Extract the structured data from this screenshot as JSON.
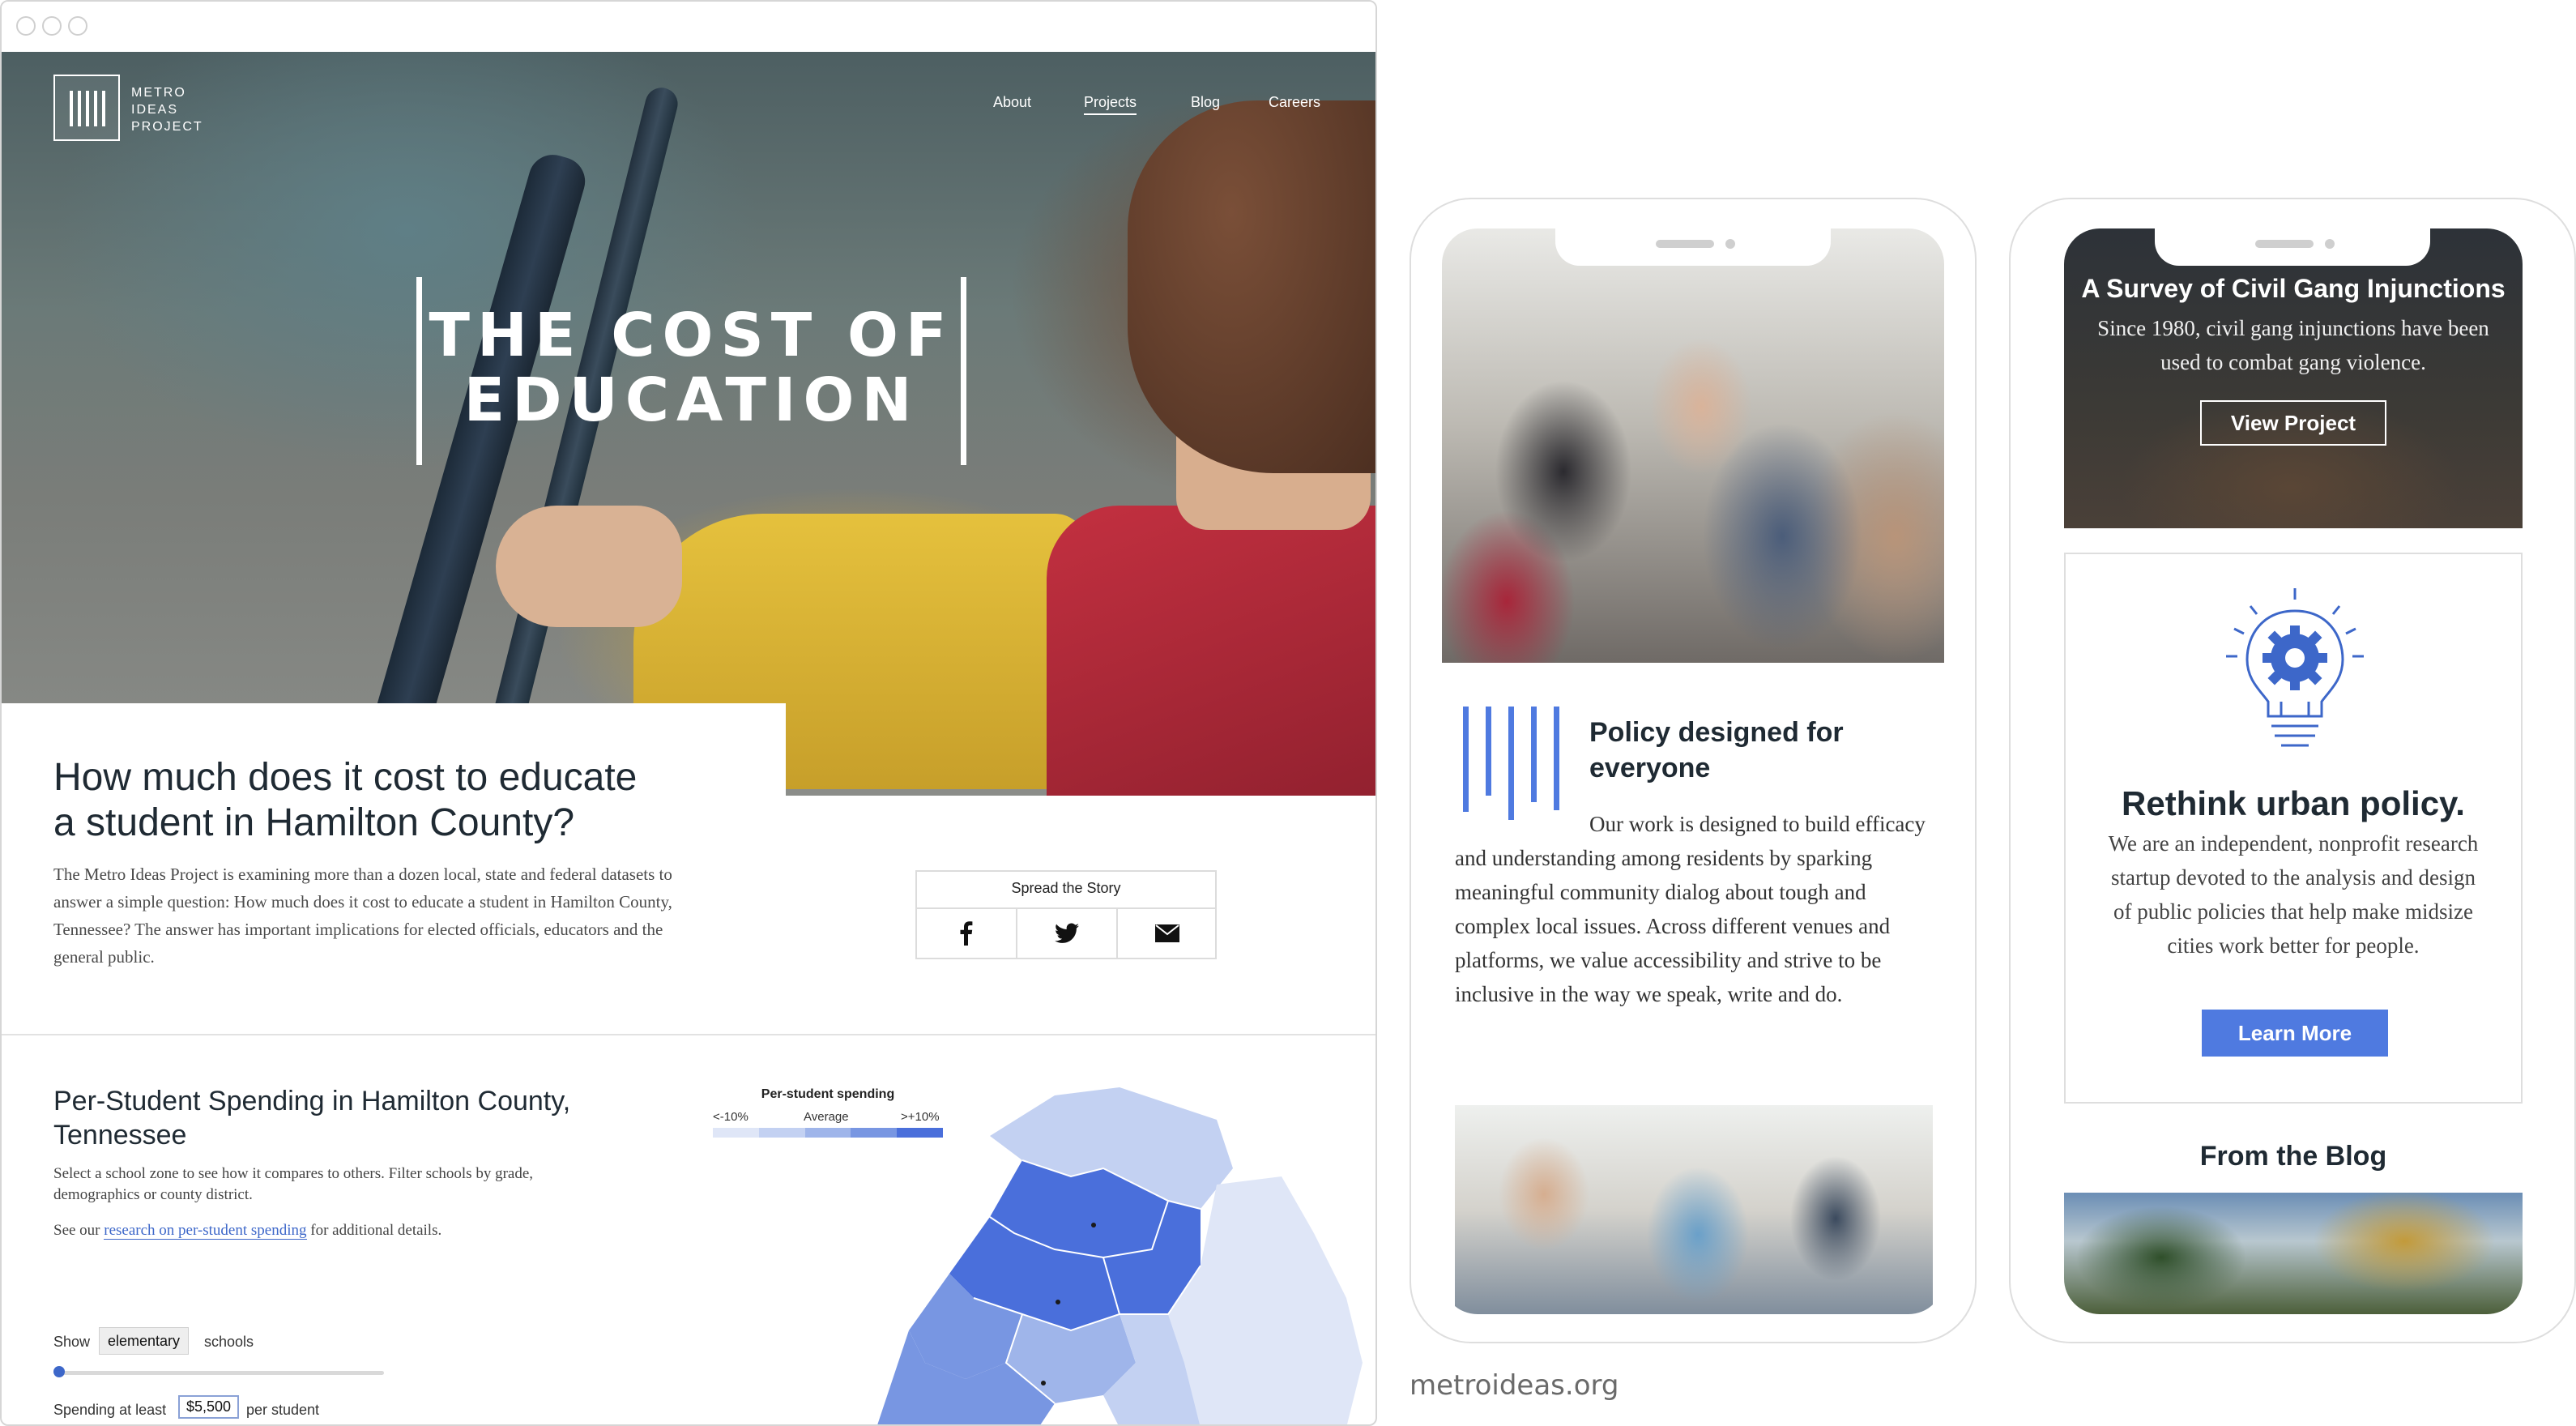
{
  "nav": {
    "logo_text": [
      "METRO",
      "IDEAS",
      "PROJECT"
    ],
    "items": [
      "About",
      "Projects",
      "Blog",
      "Careers"
    ],
    "active": "Projects"
  },
  "hero": {
    "title_line1": "THE COST OF",
    "title_line2": "EDUCATION"
  },
  "intro": {
    "heading": "How much does it cost to educate a student in Hamilton County?",
    "body": "The Metro Ideas Project is examining more than a dozen local, state and federal datasets to answer a simple question: How much does it cost to educate a student in Hamilton County, Tennessee? The answer has important implications for elected officials, educators and the general public."
  },
  "share": {
    "title": "Spread the Story",
    "buttons": [
      "facebook-icon",
      "twitter-icon",
      "email-icon"
    ]
  },
  "spending": {
    "heading": "Per-Student Spending in Hamilton County, Tennessee",
    "description": "Select a school zone to see how it compares to others. Filter schools by grade, demographics or county district.",
    "see_prefix": "See our ",
    "see_link": "research on per-student spending",
    "see_suffix": " for additional details.",
    "legend": {
      "title": "Per-student spending",
      "low": "<-10%",
      "avg": "Average",
      "high": ">+10%",
      "colors": [
        "#dfe6f7",
        "#c3d1f2",
        "#9fb5ea",
        "#7896e2",
        "#4a6fdb"
      ]
    },
    "filter": {
      "show_label": "Show",
      "grade": "elementary",
      "schools_label": "schools",
      "spending_label": "Spending at least",
      "amount": "$5,500",
      "per_student_label": "per student",
      "slider_value": 0
    }
  },
  "phone1": {
    "heading": "Policy designed for everyone",
    "body_first": "Our work is designed to build efficacy and understanding",
    "body_rest": "among residents by sparking meaningful community dialog about tough and complex local issues. Across different venues and platforms, we value accessibility and strive to be inclusive in the way we speak, write and do."
  },
  "phone2": {
    "banner_title": "A Survey of Civil Gang Injunctions",
    "banner_body": "Since 1980, civil gang injunctions have been used to combat gang violence.",
    "view_button": "View Project",
    "card_title": "Rethink urban policy.",
    "card_body": "We are an independent, nonprofit research startup devoted to the analysis and design of public policies that help make midsize cities work better for people.",
    "learn_button": "Learn More",
    "blog_title": "From the Blog"
  },
  "site_url": "metroideas.org"
}
